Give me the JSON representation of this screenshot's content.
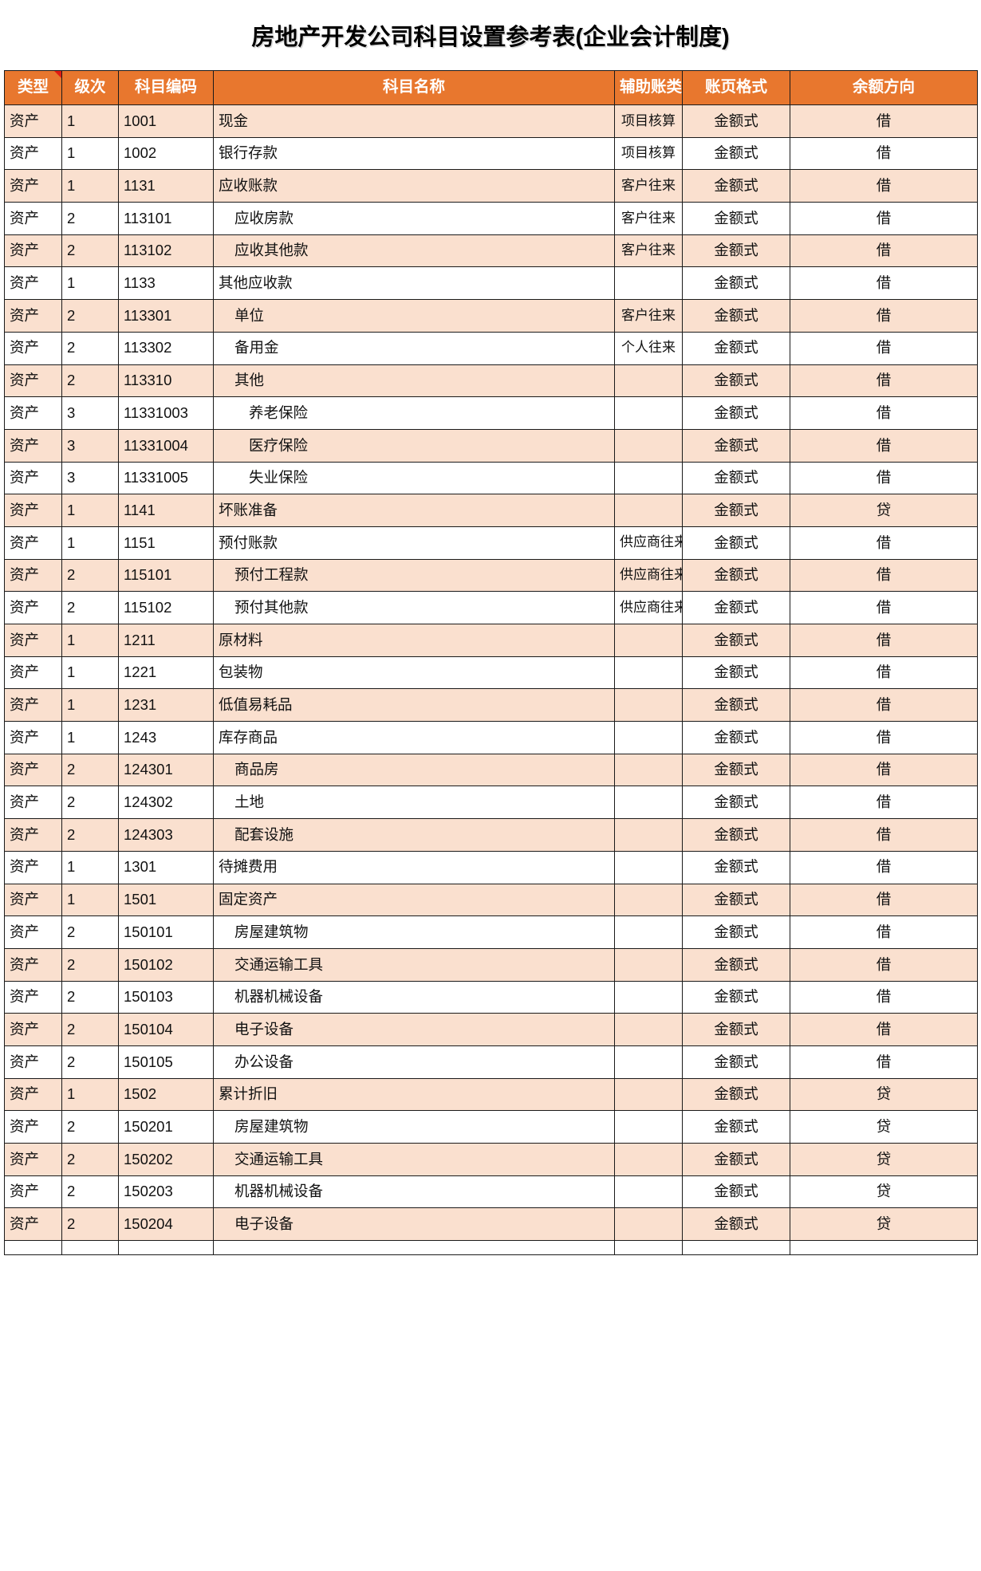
{
  "document": {
    "title": "房地产开发公司科目设置参考表(企业会计制度)"
  },
  "table": {
    "columns": [
      {
        "key": "type",
        "label": "类型"
      },
      {
        "key": "level",
        "label": "级次"
      },
      {
        "key": "code",
        "label": "科目编码"
      },
      {
        "key": "name",
        "label": "科目名称"
      },
      {
        "key": "aux",
        "label": "辅助账类型"
      },
      {
        "key": "format",
        "label": "账页格式"
      },
      {
        "key": "direction",
        "label": "余额方向"
      }
    ],
    "header_bg": "#E8772E",
    "header_fg": "#FFFFFF",
    "alt_row_bg": "#FAE0CF",
    "row_bg": "#FFFFFF",
    "comment_marker_color": "#E01B12",
    "rows": [
      {
        "type": "资产",
        "level": "1",
        "code": "1001",
        "name": "现金",
        "aux": "项目核算",
        "format": "金额式",
        "direction": "借"
      },
      {
        "type": "资产",
        "level": "1",
        "code": "1002",
        "name": "银行存款",
        "aux": "项目核算",
        "format": "金额式",
        "direction": "借"
      },
      {
        "type": "资产",
        "level": "1",
        "code": "1131",
        "name": "应收账款",
        "aux": "客户往来",
        "format": "金额式",
        "direction": "借"
      },
      {
        "type": "资产",
        "level": "2",
        "code": "113101",
        "name": "应收房款",
        "aux": "客户往来",
        "format": "金额式",
        "direction": "借"
      },
      {
        "type": "资产",
        "level": "2",
        "code": "113102",
        "name": "应收其他款",
        "aux": "客户往来",
        "format": "金额式",
        "direction": "借"
      },
      {
        "type": "资产",
        "level": "1",
        "code": "1133",
        "name": "其他应收款",
        "aux": "",
        "format": "金额式",
        "direction": "借"
      },
      {
        "type": "资产",
        "level": "2",
        "code": "113301",
        "name": "单位",
        "aux": "客户往来",
        "format": "金额式",
        "direction": "借"
      },
      {
        "type": "资产",
        "level": "2",
        "code": "113302",
        "name": "备用金",
        "aux": "个人往来",
        "format": "金额式",
        "direction": "借"
      },
      {
        "type": "资产",
        "level": "2",
        "code": "113310",
        "name": "其他",
        "aux": "",
        "format": "金额式",
        "direction": "借"
      },
      {
        "type": "资产",
        "level": "3",
        "code": "11331003",
        "name": "养老保险",
        "aux": "",
        "format": "金额式",
        "direction": "借"
      },
      {
        "type": "资产",
        "level": "3",
        "code": "11331004",
        "name": "医疗保险",
        "aux": "",
        "format": "金额式",
        "direction": "借"
      },
      {
        "type": "资产",
        "level": "3",
        "code": "11331005",
        "name": "失业保险",
        "aux": "",
        "format": "金额式",
        "direction": "借"
      },
      {
        "type": "资产",
        "level": "1",
        "code": "1141",
        "name": "坏账准备",
        "aux": "",
        "format": "金额式",
        "direction": "贷"
      },
      {
        "type": "资产",
        "level": "1",
        "code": "1151",
        "name": "预付账款",
        "aux": "供应商往来",
        "format": "金额式",
        "direction": "借"
      },
      {
        "type": "资产",
        "level": "2",
        "code": "115101",
        "name": "预付工程款",
        "aux": "供应商往来",
        "format": "金额式",
        "direction": "借"
      },
      {
        "type": "资产",
        "level": "2",
        "code": "115102",
        "name": "预付其他款",
        "aux": "供应商往来",
        "format": "金额式",
        "direction": "借"
      },
      {
        "type": "资产",
        "level": "1",
        "code": "1211",
        "name": "原材料",
        "aux": "",
        "format": "金额式",
        "direction": "借"
      },
      {
        "type": "资产",
        "level": "1",
        "code": "1221",
        "name": "包装物",
        "aux": "",
        "format": "金额式",
        "direction": "借"
      },
      {
        "type": "资产",
        "level": "1",
        "code": "1231",
        "name": "低值易耗品",
        "aux": "",
        "format": "金额式",
        "direction": "借"
      },
      {
        "type": "资产",
        "level": "1",
        "code": "1243",
        "name": "库存商品",
        "aux": "",
        "format": "金额式",
        "direction": "借"
      },
      {
        "type": "资产",
        "level": "2",
        "code": "124301",
        "name": "商品房",
        "aux": "",
        "format": "金额式",
        "direction": "借"
      },
      {
        "type": "资产",
        "level": "2",
        "code": "124302",
        "name": "土地",
        "aux": "",
        "format": "金额式",
        "direction": "借"
      },
      {
        "type": "资产",
        "level": "2",
        "code": "124303",
        "name": "配套设施",
        "aux": "",
        "format": "金额式",
        "direction": "借"
      },
      {
        "type": "资产",
        "level": "1",
        "code": "1301",
        "name": "待摊费用",
        "aux": "",
        "format": "金额式",
        "direction": "借"
      },
      {
        "type": "资产",
        "level": "1",
        "code": "1501",
        "name": "固定资产",
        "aux": "",
        "format": "金额式",
        "direction": "借"
      },
      {
        "type": "资产",
        "level": "2",
        "code": "150101",
        "name": "房屋建筑物",
        "aux": "",
        "format": "金额式",
        "direction": "借"
      },
      {
        "type": "资产",
        "level": "2",
        "code": "150102",
        "name": "交通运输工具",
        "aux": "",
        "format": "金额式",
        "direction": "借"
      },
      {
        "type": "资产",
        "level": "2",
        "code": "150103",
        "name": "机器机械设备",
        "aux": "",
        "format": "金额式",
        "direction": "借"
      },
      {
        "type": "资产",
        "level": "2",
        "code": "150104",
        "name": "电子设备",
        "aux": "",
        "format": "金额式",
        "direction": "借"
      },
      {
        "type": "资产",
        "level": "2",
        "code": "150105",
        "name": "办公设备",
        "aux": "",
        "format": "金额式",
        "direction": "借"
      },
      {
        "type": "资产",
        "level": "1",
        "code": "1502",
        "name": "累计折旧",
        "aux": "",
        "format": "金额式",
        "direction": "贷"
      },
      {
        "type": "资产",
        "level": "2",
        "code": "150201",
        "name": "房屋建筑物",
        "aux": "",
        "format": "金额式",
        "direction": "贷"
      },
      {
        "type": "资产",
        "level": "2",
        "code": "150202",
        "name": "交通运输工具",
        "aux": "",
        "format": "金额式",
        "direction": "贷"
      },
      {
        "type": "资产",
        "level": "2",
        "code": "150203",
        "name": "机器机械设备",
        "aux": "",
        "format": "金额式",
        "direction": "贷"
      },
      {
        "type": "资产",
        "level": "2",
        "code": "150204",
        "name": "电子设备",
        "aux": "",
        "format": "金额式",
        "direction": "贷"
      },
      {
        "type": "",
        "level": "",
        "code": "",
        "name": "",
        "aux": "",
        "format": "",
        "direction": ""
      }
    ]
  }
}
